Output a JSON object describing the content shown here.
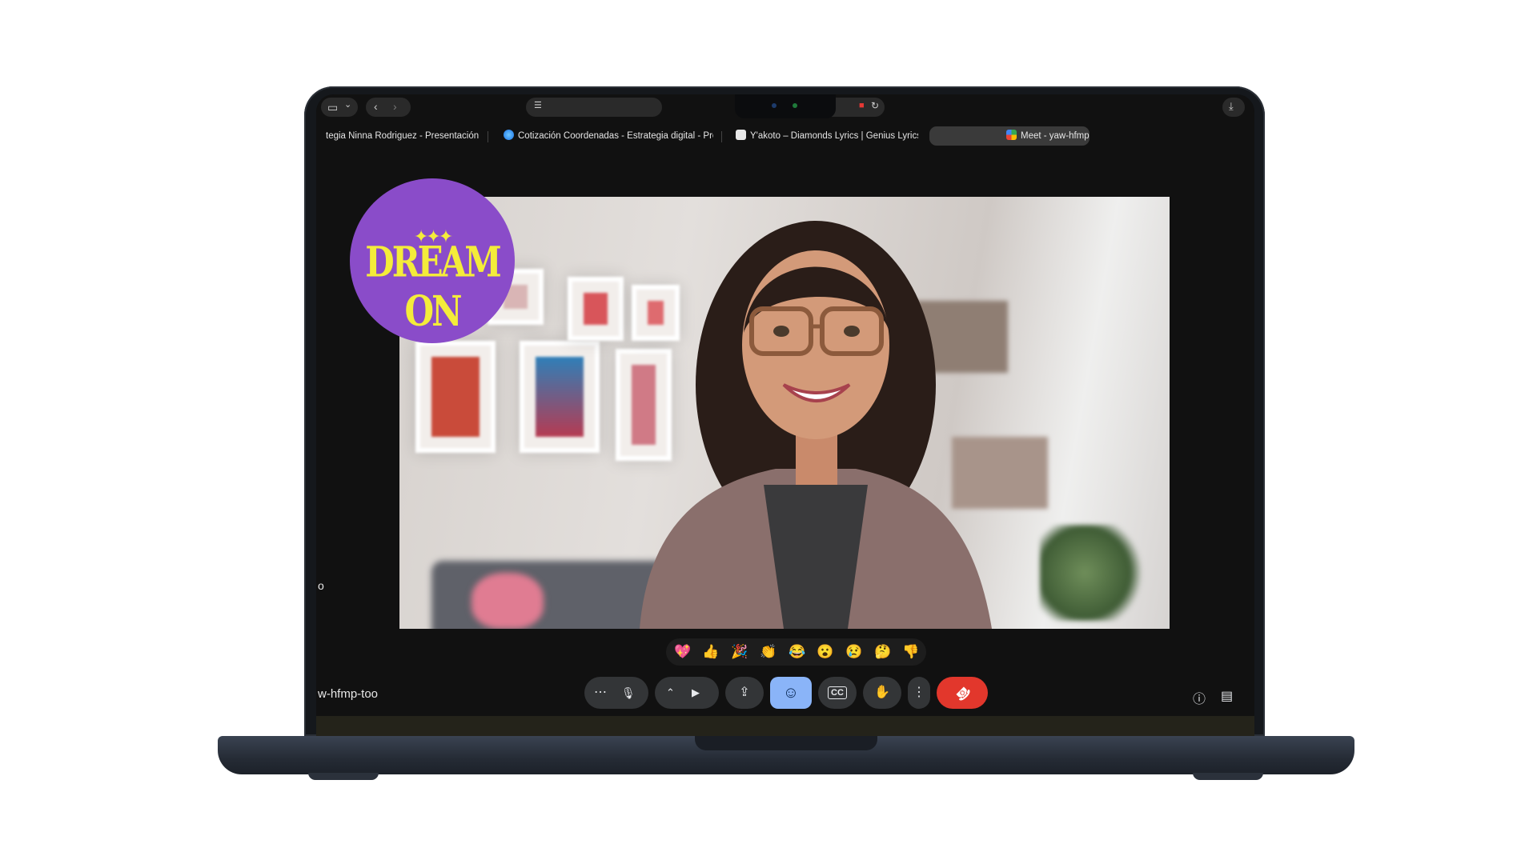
{
  "browser": {
    "tabs": [
      {
        "title": "tegia Ninna Rodriguez - Presentación",
        "active": false
      },
      {
        "title": "Cotización Coordenadas - Estrategia digital - Pres...",
        "active": false
      },
      {
        "title": "Y'akoto – Diamonds Lyrics | Genius Lyrics",
        "active": false
      },
      {
        "title": "Meet - yaw-hfmp-too",
        "active": true
      }
    ],
    "icons": [
      "sidebar-icon",
      "chevron-down-icon",
      "back-icon",
      "forward-icon",
      "site-settings-icon",
      "camera-recording-icon",
      "reload-icon",
      "download-icon"
    ]
  },
  "meeting": {
    "code": "w-hfmp-too",
    "left_edge_label": "o",
    "logo": {
      "text": "DREAM ON",
      "stars": "✦✦✦",
      "color": "#8a4cc9",
      "text_color": "#f4ec3a"
    },
    "reactions": [
      "💖",
      "👍",
      "🎉",
      "👏",
      "😂",
      "😮",
      "😢",
      "🤔",
      "👎"
    ],
    "controls": [
      {
        "name": "more-options",
        "glyph": "⋯"
      },
      {
        "name": "microphone",
        "glyph": "🎙"
      },
      {
        "name": "camera-options",
        "glyph": "⌃"
      },
      {
        "name": "camera",
        "glyph": "▶"
      },
      {
        "name": "present-screen",
        "glyph": "⇪"
      },
      {
        "name": "reactions",
        "glyph": "☺",
        "active": true
      },
      {
        "name": "captions",
        "glyph": "CC"
      },
      {
        "name": "raise-hand",
        "glyph": "✋"
      },
      {
        "name": "more-vert",
        "glyph": "⋮"
      },
      {
        "name": "leave-call",
        "glyph": "☎"
      }
    ],
    "side_controls": [
      {
        "name": "meeting-info",
        "glyph": "ⓘ"
      },
      {
        "name": "chat",
        "glyph": "▤"
      }
    ],
    "colors": {
      "accent": "#8ab4f8",
      "end_call": "#e2372c",
      "background": "#111111"
    }
  }
}
